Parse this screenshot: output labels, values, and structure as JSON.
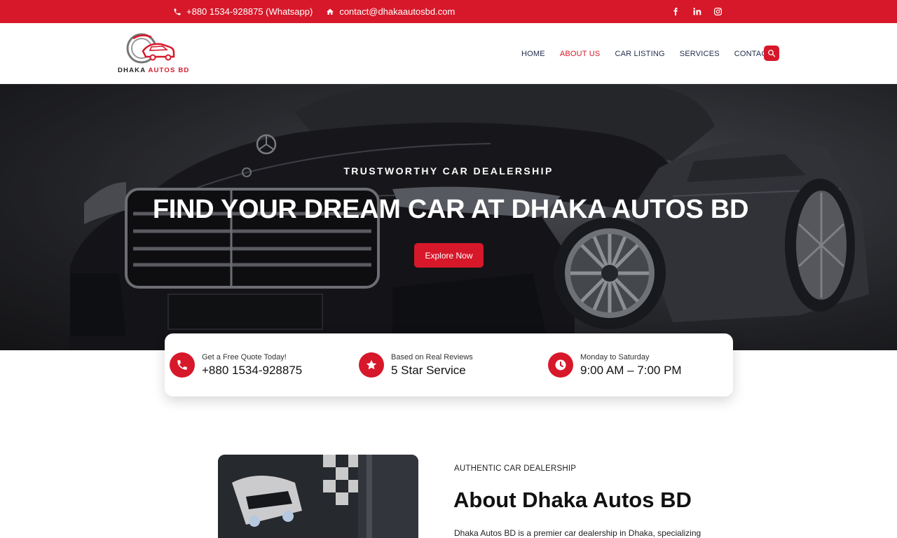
{
  "topbar": {
    "phone": "+880 1534-928875 (Whatsapp)",
    "email": "contact@dhakaautosbd.com",
    "phone_icon": "phone-icon",
    "email_icon": "home-icon",
    "social": [
      {
        "name": "facebook-icon",
        "glyph": "f"
      },
      {
        "name": "linkedin-icon",
        "glyph": "in"
      },
      {
        "name": "instagram-icon",
        "glyph": ""
      }
    ]
  },
  "brand": {
    "part1": "DHAKA ",
    "part2": "AUTOS BD"
  },
  "nav": {
    "items": [
      "HOME",
      "ABOUT US",
      "CAR LISTING",
      "SERVICES",
      "CONTACT"
    ],
    "active": "ABOUT US"
  },
  "hero": {
    "eyebrow": "TRUSTWORTHY CAR DEALERSHIP",
    "title": "FIND YOUR DREAM CAR AT DHAKA AUTOS BD",
    "cta": "Explore Now"
  },
  "info": [
    {
      "icon": "phone-icon",
      "small": "Get a Free Quote Today!",
      "big": "+880 1534-928875"
    },
    {
      "icon": "star-icon",
      "small": "Based on Real Reviews",
      "big": "5 Star Service"
    },
    {
      "icon": "clock-icon",
      "small": "Monday to Saturday",
      "big": "9:00 AM – 7:00 PM"
    }
  ],
  "about": {
    "eyebrow": "AUTHENTIC CAR DEALERSHIP",
    "title": "About Dhaka Autos BD",
    "text": "Dhaka Autos BD is a premier car dealership in Dhaka, specializing"
  },
  "colors": {
    "accent": "#d7182a",
    "nav_text": "#1f2a4a"
  }
}
